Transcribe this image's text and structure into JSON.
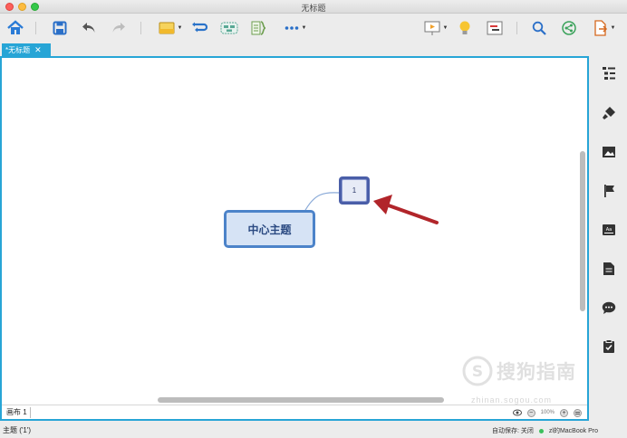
{
  "window": {
    "title": "无标题"
  },
  "toolbar": {
    "items": [
      "home-icon",
      "save-icon",
      "undo-icon",
      "redo-icon",
      "topic-icon",
      "relationship-icon",
      "boundary-icon",
      "summary-icon",
      "more-icon",
      "presentation-icon",
      "brainstorm-icon",
      "gantt-icon",
      "search-icon",
      "share-icon",
      "export-icon"
    ]
  },
  "tabs": [
    {
      "label": "*无标题",
      "close": "✕"
    }
  ],
  "map": {
    "central_topic": "中心主题",
    "subtopic": "1"
  },
  "sheet": {
    "tab_label": "画布 1",
    "zoom": "100%",
    "zoom_in": "+",
    "zoom_out": "−"
  },
  "sidebar": {
    "items": [
      "outline-icon",
      "format-icon",
      "image-icon",
      "marker-icon",
      "notes-icon",
      "document-icon",
      "comment-icon",
      "task-icon"
    ]
  },
  "status": {
    "selection": "主题 ('1')",
    "autosave": "自动保存: 关闭",
    "user": "zl的MacBook Pro"
  },
  "watermark": {
    "text": "搜狗指南",
    "url": "zhinan.sogou.com"
  },
  "colors": {
    "accent": "#27a5d6",
    "central_border": "#4c83c9",
    "arrow": "#b1252a"
  }
}
